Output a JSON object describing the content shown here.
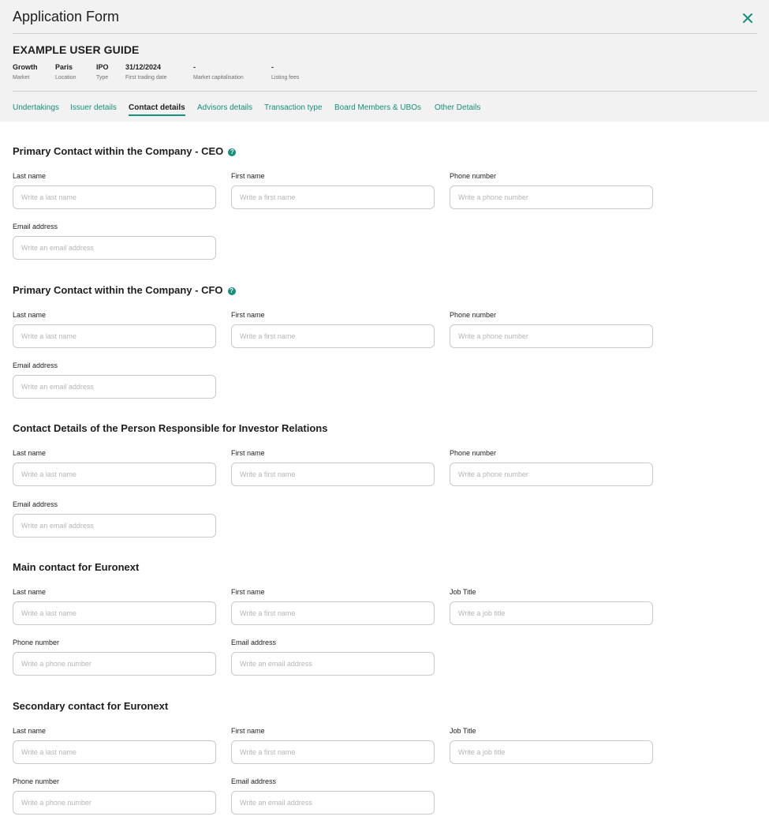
{
  "window": {
    "title": "Application Form",
    "close_icon": "close-icon",
    "accent_color": "#168f7c"
  },
  "guide": {
    "title": "EXAMPLE USER GUIDE",
    "meta": [
      {
        "value": "Growth",
        "label": "Market"
      },
      {
        "value": "Paris",
        "label": "Location"
      },
      {
        "value": "IPO",
        "label": "Type"
      },
      {
        "value": "31/12/2024",
        "label": "First trading date"
      },
      {
        "value": "-",
        "label": "Market capitalisation"
      },
      {
        "value": "-",
        "label": "Listing fees"
      }
    ]
  },
  "tabs": [
    {
      "label": "Undertakings"
    },
    {
      "label": "Issuer details"
    },
    {
      "label": "Contact details",
      "active": true
    },
    {
      "label": "Advisors details"
    },
    {
      "label": "Transaction type"
    },
    {
      "label": "Board Members & UBOs"
    },
    {
      "label": "Other Details"
    }
  ],
  "sections": [
    {
      "title": "Primary Contact within the Company - CEO",
      "help_icon": "help-icon",
      "fields": [
        {
          "label": "Last name",
          "placeholder": "Write a last name"
        },
        {
          "label": "First name",
          "placeholder": "Write a first name"
        },
        {
          "label": "Phone number",
          "placeholder": "Write a phone number"
        },
        {
          "label": "Email address",
          "placeholder": "Write an email address"
        }
      ]
    },
    {
      "title": "Primary Contact within the Company - CFO",
      "help_icon": "help-icon",
      "fields": [
        {
          "label": "Last name",
          "placeholder": "Write a last name"
        },
        {
          "label": "First name",
          "placeholder": "Write a first name"
        },
        {
          "label": "Phone number",
          "placeholder": "Write a phone number"
        },
        {
          "label": "Email address",
          "placeholder": "Write an email address"
        }
      ]
    },
    {
      "title": "Contact Details of the Person Responsible for Investor Relations",
      "fields": [
        {
          "label": "Last name",
          "placeholder": "Write a last name"
        },
        {
          "label": "First name",
          "placeholder": "Write a first name"
        },
        {
          "label": "Phone number",
          "placeholder": "Write a phone number"
        },
        {
          "label": "Email address",
          "placeholder": "Write an email address"
        }
      ]
    },
    {
      "title": "Main contact for Euronext",
      "fields": [
        {
          "label": "Last name",
          "placeholder": "Write a last name"
        },
        {
          "label": "First name",
          "placeholder": "Write a first name"
        },
        {
          "label": "Job Title",
          "placeholder": "Write a job title"
        },
        {
          "label": "Phone number",
          "placeholder": "Write a phone number"
        },
        {
          "label": "Email address",
          "placeholder": "Write an email address"
        }
      ]
    },
    {
      "title": "Secondary contact for Euronext",
      "fields": [
        {
          "label": "Last name",
          "placeholder": "Write a last name"
        },
        {
          "label": "First name",
          "placeholder": "Write a first name"
        },
        {
          "label": "Job Title",
          "placeholder": "Write a job title"
        },
        {
          "label": "Phone number",
          "placeholder": "Write a phone number"
        },
        {
          "label": "Email address",
          "placeholder": "Write an email address"
        }
      ]
    }
  ]
}
